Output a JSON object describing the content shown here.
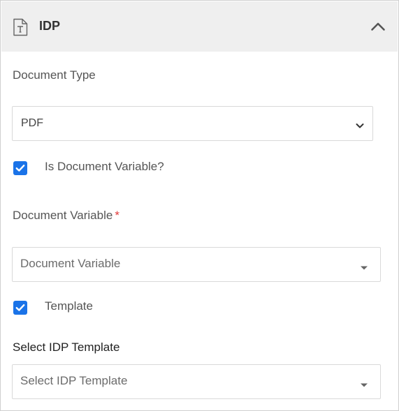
{
  "header": {
    "title": "IDP",
    "icon": "text-document-icon",
    "collapse_icon": "chevron-up-icon"
  },
  "document_type": {
    "label": "Document Type",
    "selected": "PDF"
  },
  "is_document_variable": {
    "label": "Is Document Variable?",
    "checked": true
  },
  "document_variable": {
    "label": "Document Variable",
    "required_mark": "*",
    "placeholder": "Document Variable"
  },
  "template": {
    "label": "Template",
    "checked": true
  },
  "idp_template": {
    "label": "Select IDP Template",
    "placeholder": "Select IDP Template"
  },
  "colors": {
    "accent": "#1a73e8",
    "header_bg": "#efefef",
    "required": "#e23b3b"
  }
}
